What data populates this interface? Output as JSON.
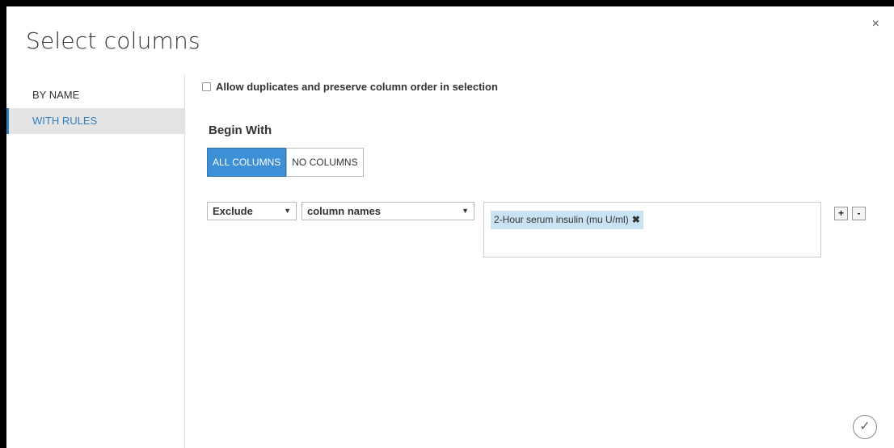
{
  "dialog": {
    "title": "Select columns",
    "close_glyph": "×"
  },
  "sidebar": {
    "items": [
      {
        "label": "BY NAME",
        "active": false
      },
      {
        "label": "WITH RULES",
        "active": true
      }
    ]
  },
  "options": {
    "allow_duplicates_label": "Allow duplicates and preserve column order in selection",
    "allow_duplicates_checked": false
  },
  "begin_with": {
    "heading": "Begin With",
    "buttons": [
      "ALL COLUMNS",
      "NO COLUMNS"
    ],
    "selected": "ALL COLUMNS"
  },
  "rule": {
    "action": "Exclude",
    "criteria": "column names",
    "dropdown_glyph": "▼",
    "tags": [
      {
        "label": "2-Hour serum insulin (mu U/ml)",
        "remove_glyph": "✖"
      }
    ],
    "add_label": "+",
    "remove_label": "-"
  },
  "footer": {
    "ok_glyph": "✓",
    "ok_icon": "checkmark-circle-icon"
  },
  "colors": {
    "accent": "#3d8fd6",
    "tag_bg": "#c9e3f2",
    "sidebar_active_bg": "#e4e4e4"
  }
}
